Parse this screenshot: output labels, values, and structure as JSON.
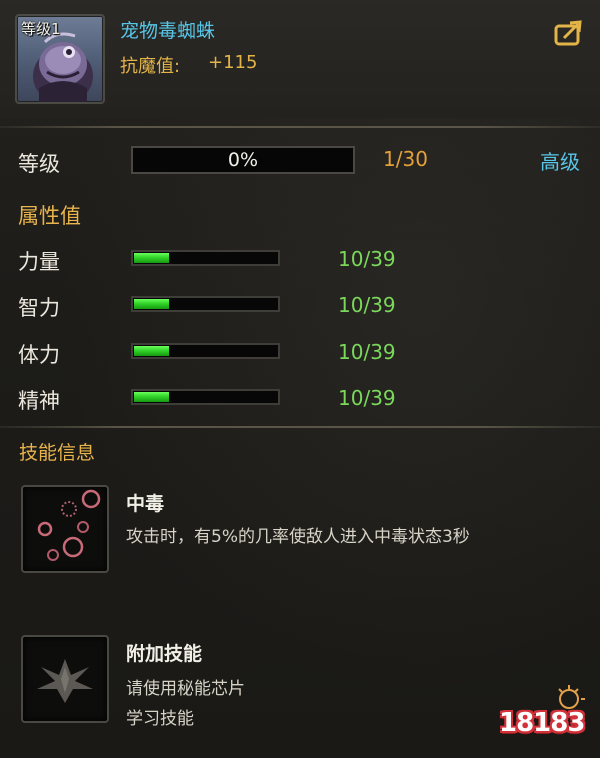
{
  "pet": {
    "level_tag": "等级1",
    "name": "宠物毒蜘蛛",
    "resist_label": "抗魔值:",
    "resist_value": "+115",
    "portrait_icon": "poison-spider-portrait",
    "share_icon": "share-arrow-icon"
  },
  "level": {
    "label": "等级",
    "percent_text": "0%",
    "progress_fraction": 0,
    "count": "1/30",
    "advanced_label": "高级"
  },
  "attributes": {
    "title": "属性值",
    "items": [
      {
        "label": "力量",
        "value": "10/39",
        "fraction": 0.2564
      },
      {
        "label": "智力",
        "value": "10/39",
        "fraction": 0.2564
      },
      {
        "label": "体力",
        "value": "10/39",
        "fraction": 0.2564
      },
      {
        "label": "精神",
        "value": "10/39",
        "fraction": 0.2564
      }
    ]
  },
  "skills": {
    "title": "技能信息",
    "items": [
      {
        "name": "中毒",
        "desc_lines": [
          "攻击时，有5%的几率使敌人进入中毒状态3秒"
        ],
        "icon": "poison-bubbles-icon"
      },
      {
        "name": "附加技能",
        "desc_lines": [
          "请使用秘能芯片",
          "学习技能"
        ],
        "icon": "locked-skill-wings-icon"
      }
    ]
  },
  "watermark": {
    "text": "18183"
  },
  "colors": {
    "accent_blue": "#57c6e8",
    "accent_gold": "#e8b44c",
    "level_count": "#e3a13a",
    "stat_green": "#7ad85a"
  }
}
